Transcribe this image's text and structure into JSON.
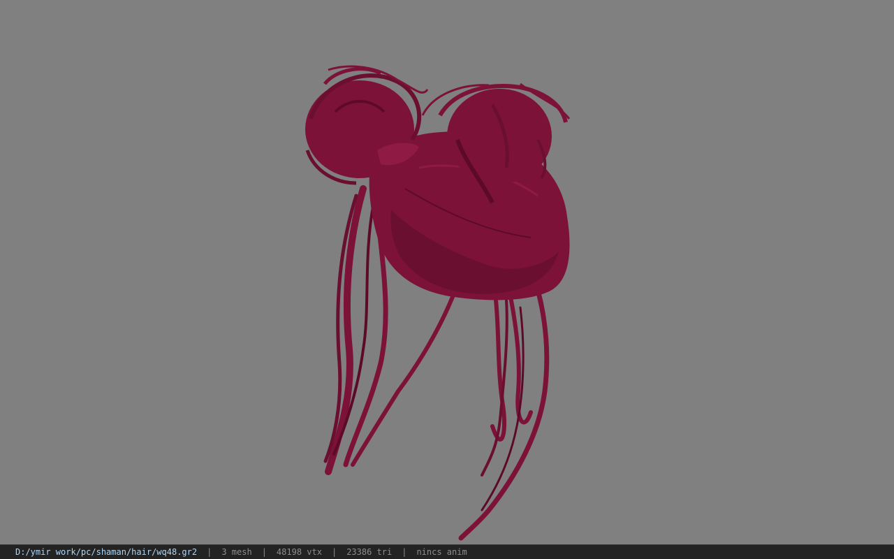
{
  "viewport": {
    "background_color": "#808080",
    "model": {
      "description_icon": "hair-mesh-icon",
      "color": "#7d1238",
      "shadow_color": "#5c0a28",
      "highlight_color": "#9a1c4a"
    }
  },
  "status_bar": {
    "file_path": "D:/ymir work/pc/shaman/hair/wq48.gr2",
    "separator": "|",
    "mesh_count": "3 mesh",
    "vertex_count": "48198 vtx",
    "triangle_count": "23386 tri",
    "animation": "nincs anim",
    "path_color": "#a9d8ff"
  }
}
